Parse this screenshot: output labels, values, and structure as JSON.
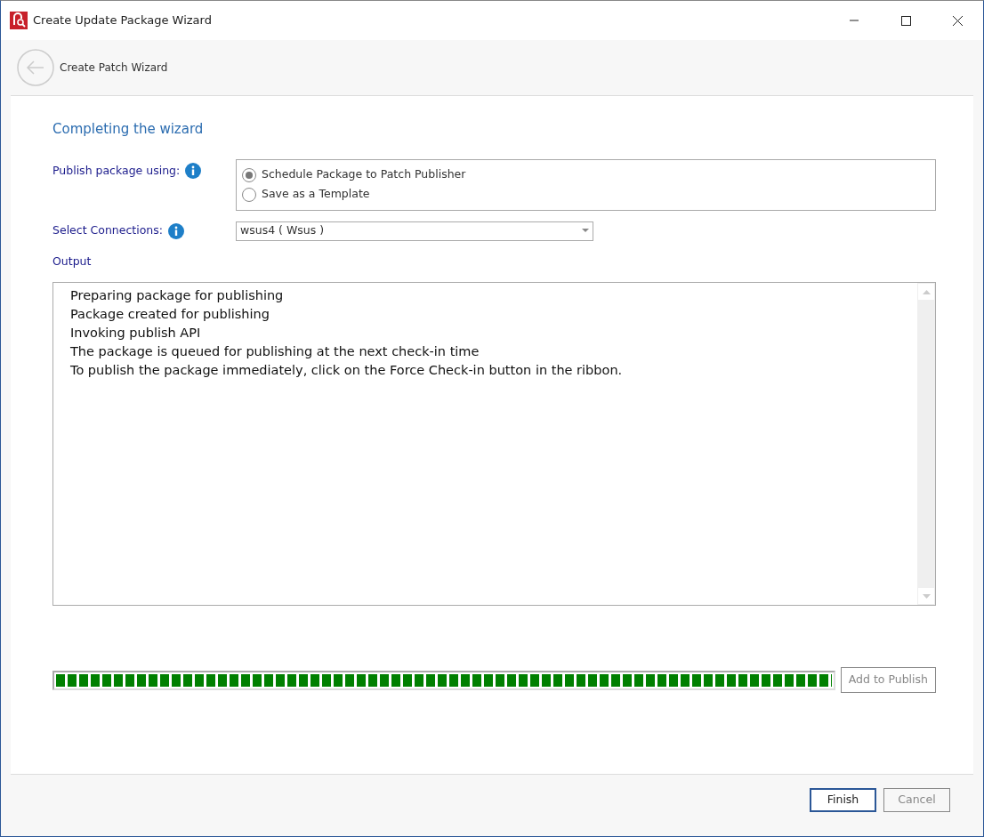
{
  "window": {
    "title": "Create Update Package Wizard"
  },
  "header": {
    "title": "Create Patch Wizard"
  },
  "page_title": "Completing the wizard",
  "publish": {
    "label": "Publish package using:",
    "options": [
      {
        "label": "Schedule Package to Patch Publisher",
        "selected": true
      },
      {
        "label": "Save as a Template",
        "selected": false
      }
    ]
  },
  "connections": {
    "label": "Select Connections:",
    "value": "wsus4 ( Wsus )"
  },
  "output": {
    "label": "Output",
    "lines": [
      "Preparing package for publishing",
      "Package created for publishing",
      "Invoking publish API",
      "The package is queued for publishing at the next check-in time",
      "To publish the package immediately, click on the Force Check-in button in the ribbon."
    ]
  },
  "progress": {
    "level": 1
  },
  "add_button": {
    "label": "Add to Publish",
    "disabled": true
  },
  "buttons": [
    {
      "label": "Finish",
      "disabled": false,
      "default": true
    },
    {
      "label": "Cancel",
      "disabled": true,
      "default": false
    }
  ]
}
